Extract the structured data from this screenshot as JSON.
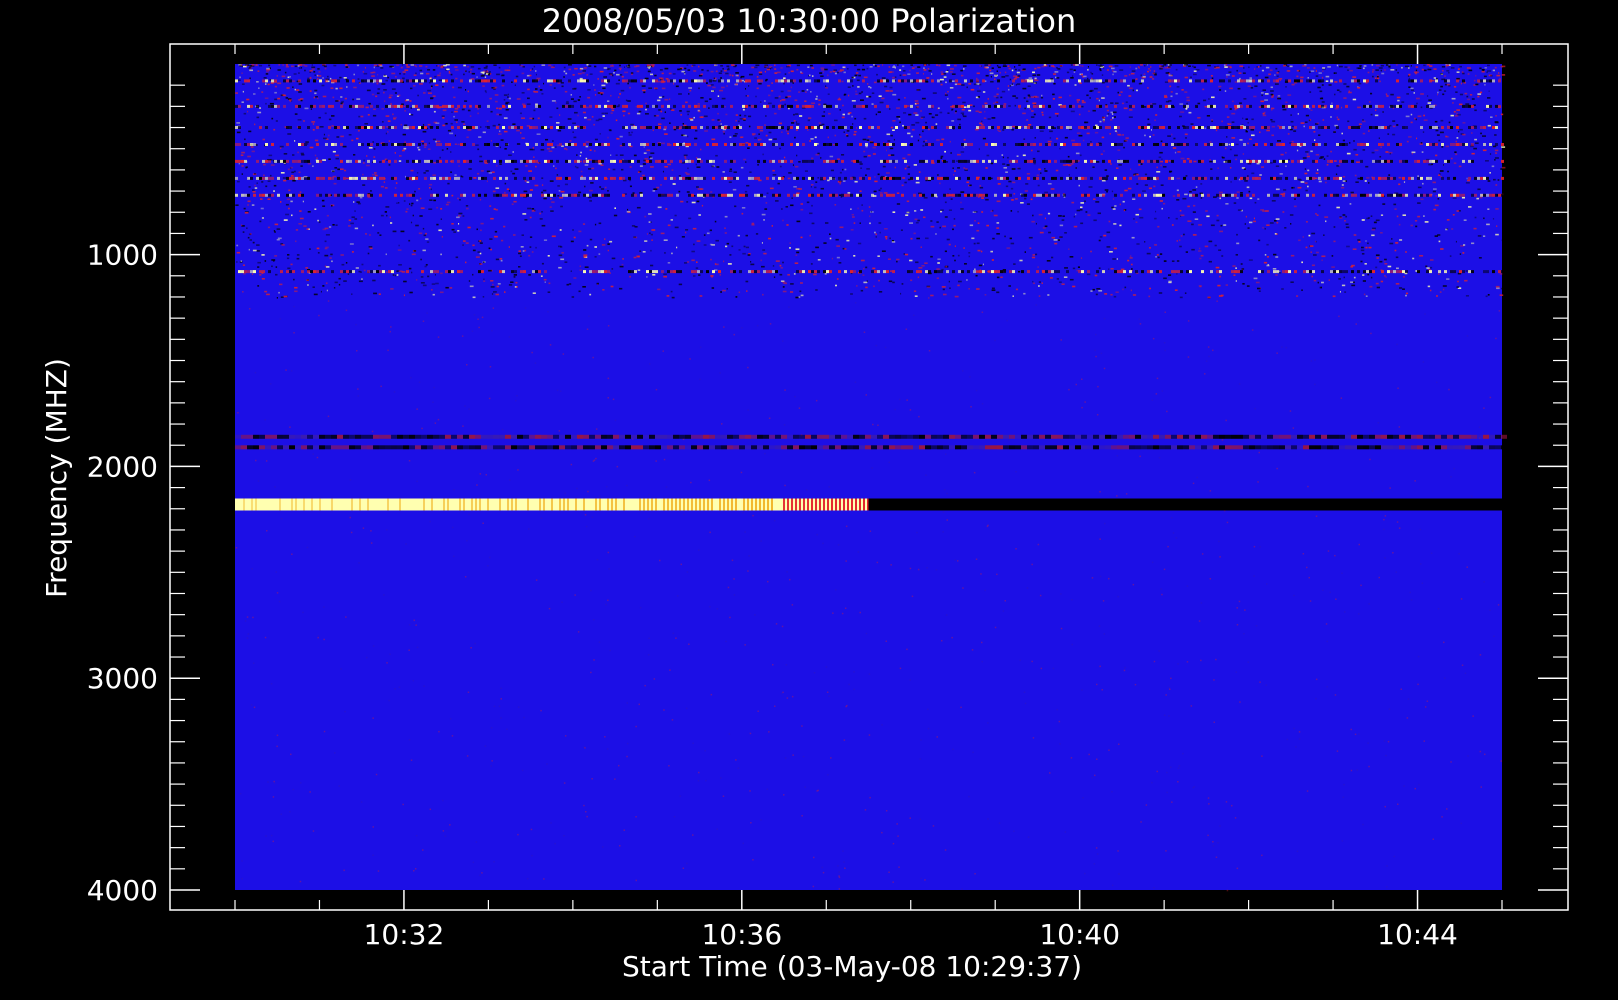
{
  "chart_data": {
    "type": "heatmap",
    "title": "2008/05/03 10:30:00 Polarization",
    "xlabel": "Start Time (03-May-08 10:29:37)",
    "ylabel": "Frequency (MHZ)",
    "x_ticks": [
      "10:32",
      "10:36",
      "10:40",
      "10:44"
    ],
    "y_ticks": [
      "1000",
      "2000",
      "3000",
      "4000"
    ],
    "x_range": [
      "10:30",
      "10:45"
    ],
    "y_range": [
      100,
      4000
    ],
    "y_axis_inverted": true,
    "colormap": {
      "background": "#1c0fe6",
      "low": "#000000",
      "mid": "#e2232a",
      "high": "#ffffb0"
    },
    "features": [
      {
        "kind": "strong-band",
        "freq_mhz": 2180,
        "from": "10:30",
        "to": "10:37:30",
        "polarity": "high"
      },
      {
        "kind": "strong-band",
        "freq_mhz": 2180,
        "from": "10:37:30",
        "to": "10:45",
        "polarity": "low"
      },
      {
        "kind": "weak-band",
        "freq_mhz": 1860,
        "from": "10:30",
        "to": "10:45",
        "polarity": "mixed"
      },
      {
        "kind": "weak-band",
        "freq_mhz": 1910,
        "from": "10:30",
        "to": "10:45",
        "polarity": "mixed"
      },
      {
        "kind": "noisy-region",
        "freq_mhz_from": 100,
        "freq_mhz_to": 1200,
        "intensity": "high"
      },
      {
        "kind": "interference-lines",
        "freq_mhz": [
          180,
          300,
          400,
          480,
          560,
          640,
          720,
          1080
        ]
      }
    ]
  }
}
